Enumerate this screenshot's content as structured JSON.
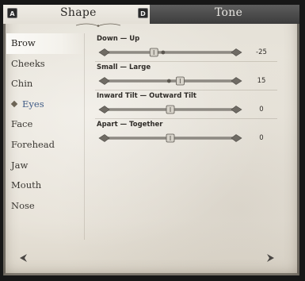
{
  "tabs": {
    "shape_label": "Shape",
    "tone_label": "Tone",
    "prev_key": "A",
    "next_key": "D"
  },
  "sidebar": {
    "items": [
      {
        "label": "Brow",
        "selected": true
      },
      {
        "label": "Cheeks"
      },
      {
        "label": "Chin"
      },
      {
        "label": "Eyes",
        "active": true
      },
      {
        "label": "Face"
      },
      {
        "label": "Forehead"
      },
      {
        "label": "Jaw"
      },
      {
        "label": "Mouth"
      },
      {
        "label": "Nose"
      }
    ]
  },
  "sliders": [
    {
      "label": "Down — Up",
      "value": "-25",
      "fraction": 0.375,
      "ghost_fraction": 0.445
    },
    {
      "label": "Small — Large",
      "value": "15",
      "fraction": 0.575,
      "ghost_fraction": 0.49
    },
    {
      "label": "Inward Tilt — Outward Tilt",
      "value": "0",
      "fraction": 0.5
    },
    {
      "label": "Apart — Together",
      "value": "0",
      "fraction": 0.5
    }
  ],
  "colors": {
    "parchment": "#e7e2d8",
    "active_item": "#3f5b86",
    "tone_tab": "#4a4a4a"
  },
  "icons": {
    "prev": "arrow-left-icon",
    "next": "arrow-right-icon",
    "active_marker": "diamond-icon"
  }
}
